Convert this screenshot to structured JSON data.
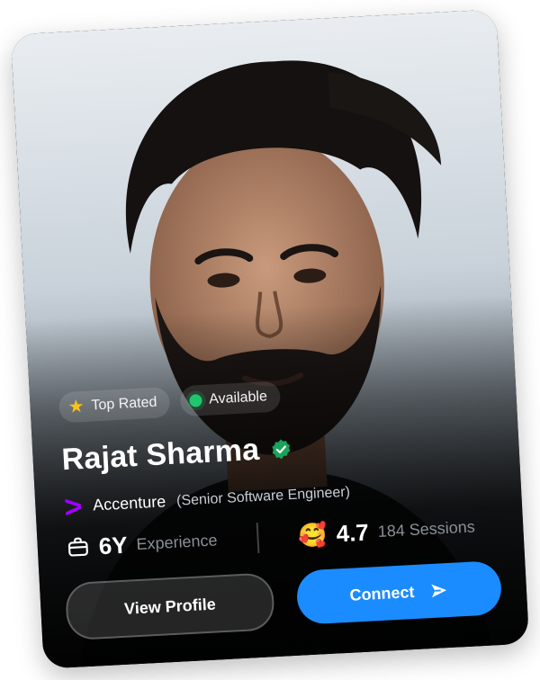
{
  "profile": {
    "badges": [
      {
        "icon": "star-icon",
        "label": "Top Rated"
      },
      {
        "icon": "available-dot-icon",
        "label": "Available"
      }
    ],
    "name": "Rajat Sharma",
    "company": "Accenture",
    "role": "(Senior Software Engineer)",
    "experience_value": "6Y",
    "experience_label": "Experience",
    "rating": "4.7",
    "sessions": "184 Sessions"
  },
  "actions": {
    "view_profile": "View Profile",
    "connect": "Connect"
  },
  "colors": {
    "primary": "#1a8cff",
    "available": "#1ec76b",
    "star": "#f7c21d",
    "verified": "#1aa35b",
    "accenture": "#a100ff"
  }
}
